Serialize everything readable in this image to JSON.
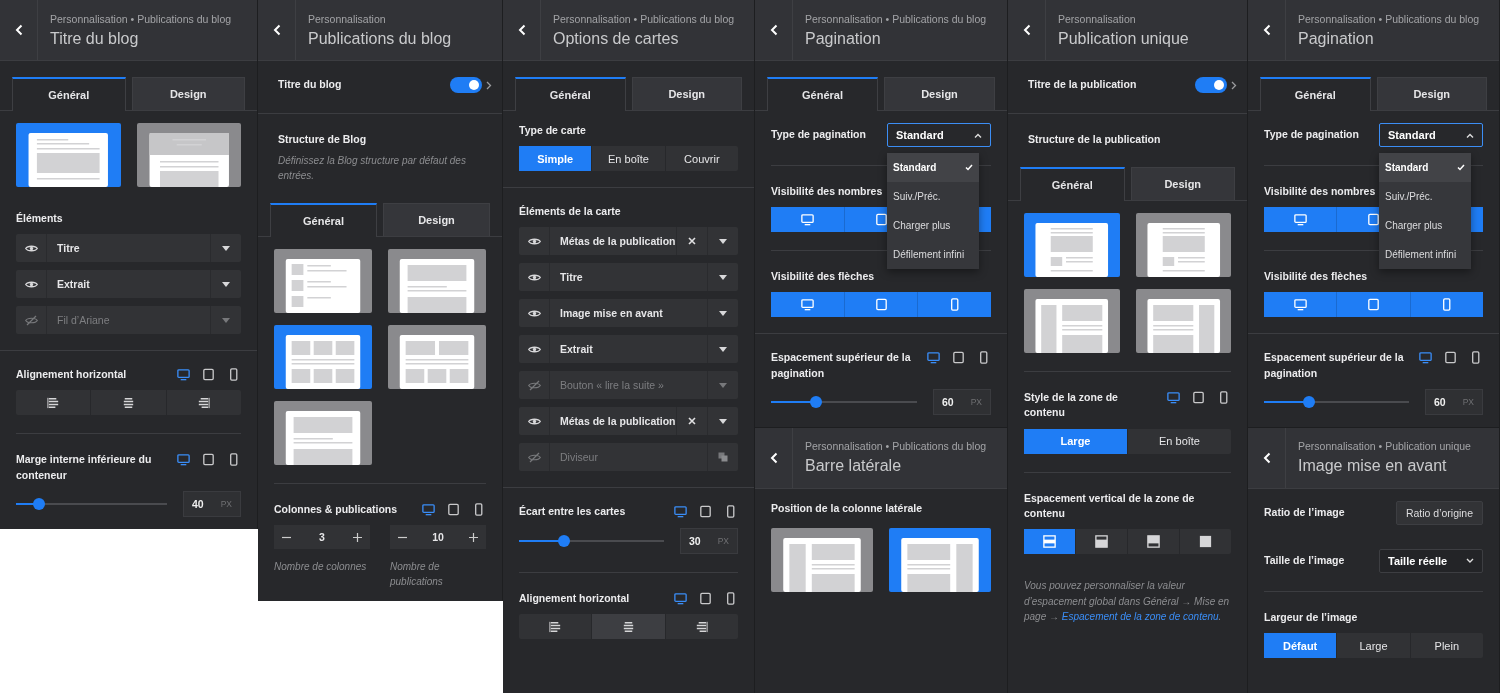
{
  "columns": [
    {
      "panels": [
        {
          "breadcrumb": "Personnalisation • Publications du blog",
          "title": "Titre du blog",
          "blocks": [
            {
              "kind": "tabs",
              "items": [
                {
                  "label": "Général",
                  "selected": true
                },
                {
                  "label": "Design",
                  "selected": false
                }
              ]
            },
            {
              "kind": "layouts",
              "items": [
                {
                  "kind": "stack",
                  "selected": true
                },
                {
                  "kind": "banner",
                  "selected": false
                }
              ]
            },
            {
              "kind": "elements",
              "label": "Éléments",
              "items": [
                {
                  "kind": "element",
                  "label": "Titre",
                  "visible": true,
                  "removable": false
                },
                {
                  "kind": "element",
                  "label": "Extrait",
                  "visible": true,
                  "removable": false
                },
                {
                  "kind": "element",
                  "label": "Fil d’Ariane",
                  "visible": false,
                  "removable": false
                }
              ]
            },
            {
              "kind": "divider",
              "inset": false
            },
            {
              "kind": "alignment",
              "label": "Alignement horizontal",
              "devices": [
                {
                  "kind": "desktop",
                  "selected": true
                },
                {
                  "kind": "tablet",
                  "selected": false
                },
                {
                  "kind": "mobile",
                  "selected": false
                }
              ],
              "options": [
                {
                  "kind": "align-left",
                  "selected": false
                },
                {
                  "kind": "align-center",
                  "selected": false
                },
                {
                  "kind": "align-right",
                  "selected": false
                }
              ]
            },
            {
              "kind": "divider",
              "inset": true
            },
            {
              "kind": "slider",
              "label": "Marge interne inférieure du conteneur",
              "devices": [
                {
                  "kind": "desktop",
                  "selected": true
                },
                {
                  "kind": "tablet",
                  "selected": false
                },
                {
                  "kind": "mobile",
                  "selected": false
                }
              ],
              "level": 0.15,
              "value": "40",
              "unit": "PX"
            }
          ]
        }
      ]
    },
    {
      "panels": [
        {
          "breadcrumb": "Personnalisation",
          "title": "Publications du blog",
          "blocks": [
            {
              "kind": "toggle",
              "label": "Titre du blog",
              "on": true
            },
            {
              "kind": "divider",
              "inset": false
            },
            {
              "kind": "heading",
              "label": "Structure de Blog",
              "description": "Définissez la Blog structure par défaut des entrées."
            },
            {
              "kind": "tabs",
              "items": [
                {
                  "label": "Général",
                  "selected": true
                },
                {
                  "label": "Design",
                  "selected": false
                }
              ]
            },
            {
              "kind": "layouts",
              "items": [
                {
                  "kind": "list",
                  "selected": false
                },
                {
                  "kind": "single",
                  "selected": false
                },
                {
                  "kind": "grid3",
                  "selected": true
                },
                {
                  "kind": "mixed",
                  "selected": false
                },
                {
                  "kind": "single",
                  "selected": false
                }
              ]
            },
            {
              "kind": "divider",
              "inset": true
            },
            {
              "kind": "steppers",
              "label": "Colonnes & publications",
              "devices": [
                {
                  "kind": "desktop",
                  "selected": true
                },
                {
                  "kind": "tablet",
                  "selected": false
                },
                {
                  "kind": "mobile",
                  "selected": false
                }
              ],
              "fields": [
                {
                  "value": "3",
                  "caption": "Nombre de colonnes"
                },
                {
                  "value": "10",
                  "caption": "Nombre de publications"
                }
              ]
            }
          ]
        }
      ]
    },
    {
      "panels": [
        {
          "breadcrumb": "Personnalisation • Publications du blog",
          "title": "Options de cartes",
          "blocks": [
            {
              "kind": "tabs",
              "items": [
                {
                  "label": "Général",
                  "selected": true
                },
                {
                  "label": "Design",
                  "selected": false
                }
              ]
            },
            {
              "kind": "segmented",
              "label": "Type de carte",
              "options": [
                {
                  "label": "Simple",
                  "selected": true
                },
                {
                  "label": "En boîte",
                  "selected": false
                },
                {
                  "label": "Couvrir",
                  "selected": false
                }
              ]
            },
            {
              "kind": "divider",
              "inset": false
            },
            {
              "kind": "elements",
              "label": "Éléments de la carte",
              "items": [
                {
                  "kind": "element",
                  "label": "Métas de la publication",
                  "visible": true,
                  "removable": true
                },
                {
                  "kind": "element",
                  "label": "Titre",
                  "visible": true,
                  "removable": false
                },
                {
                  "kind": "element",
                  "label": "Image mise en avant",
                  "visible": true,
                  "removable": false
                },
                {
                  "kind": "element",
                  "label": "Extrait",
                  "visible": true,
                  "removable": false
                },
                {
                  "kind": "element",
                  "label": "Bouton « lire la suite »",
                  "visible": false,
                  "removable": false
                },
                {
                  "kind": "element",
                  "label": "Métas de la publication",
                  "visible": true,
                  "removable": true
                },
                {
                  "kind": "divider",
                  "label": "Diviseur",
                  "visible": false,
                  "removable": false
                }
              ]
            },
            {
              "kind": "divider",
              "inset": false
            },
            {
              "kind": "slider",
              "label": "Écart entre les cartes",
              "devices": [
                {
                  "kind": "desktop",
                  "selected": true
                },
                {
                  "kind": "tablet",
                  "selected": false
                },
                {
                  "kind": "mobile",
                  "selected": false
                }
              ],
              "level": 0.31,
              "value": "30",
              "unit": "PX"
            },
            {
              "kind": "divider",
              "inset": true
            },
            {
              "kind": "alignment",
              "label": "Alignement horizontal",
              "devices": [
                {
                  "kind": "desktop",
                  "selected": true
                },
                {
                  "kind": "tablet",
                  "selected": false
                },
                {
                  "kind": "mobile",
                  "selected": false
                }
              ],
              "options": [
                {
                  "kind": "align-left",
                  "selected": false
                },
                {
                  "kind": "align-center",
                  "selected": true
                },
                {
                  "kind": "align-right",
                  "selected": false
                }
              ]
            }
          ]
        }
      ]
    },
    {
      "panels": [
        {
          "breadcrumb": "Personnalisation • Publications du blog",
          "title": "Pagination",
          "blocks": [
            {
              "kind": "tabs",
              "items": [
                {
                  "label": "Général",
                  "selected": true
                },
                {
                  "label": "Design",
                  "selected": false
                }
              ]
            },
            {
              "kind": "select",
              "label": "Type de pagination",
              "value": "Standard",
              "open": true,
              "options": [
                {
                  "label": "Standard",
                  "selected": true
                },
                {
                  "label": "Suiv./Préc.",
                  "selected": false
                },
                {
                  "label": "Charger plus",
                  "selected": false
                },
                {
                  "label": "Défilement infini",
                  "selected": false
                }
              ]
            },
            {
              "kind": "divider",
              "inset": true
            },
            {
              "kind": "segmented",
              "label": "Visibilité des nombres",
              "options": [
                {
                  "kind": "desktop",
                  "selected": true
                },
                {
                  "kind": "tablet",
                  "selected": true
                },
                {
                  "selected": true
                }
              ]
            },
            {
              "kind": "divider",
              "inset": true
            },
            {
              "kind": "segmented",
              "label": "Visibilité des flèches",
              "options": [
                {
                  "kind": "desktop",
                  "selected": true
                },
                {
                  "kind": "tablet",
                  "selected": true
                },
                {
                  "kind": "mobile",
                  "selected": true
                }
              ]
            },
            {
              "kind": "divider",
              "inset": false
            },
            {
              "kind": "slider",
              "label": "Espacement supérieur de la pagination",
              "devices": [
                {
                  "kind": "desktop",
                  "selected": true
                },
                {
                  "kind": "tablet",
                  "selected": false
                },
                {
                  "kind": "mobile",
                  "selected": false
                }
              ],
              "level": 0.31,
              "value": "60",
              "unit": "PX"
            }
          ]
        },
        {
          "breadcrumb": "Personnalisation • Publications du blog",
          "title": "Barre latérale",
          "blocks": [
            {
              "kind": "layouts",
              "label": "Position de la colonne latérale",
              "items": [
                {
                  "kind": "sidebar-left",
                  "selected": false
                },
                {
                  "kind": "sidebar-right",
                  "selected": true
                }
              ]
            }
          ]
        }
      ]
    },
    {
      "panels": [
        {
          "breadcrumb": "Personnalisation",
          "title": "Publication unique",
          "blocks": [
            {
              "kind": "toggle",
              "label": "Titre de la publication",
              "on": true
            },
            {
              "kind": "divider",
              "inset": false
            },
            {
              "kind": "heading",
              "label": "Structure de la publication"
            },
            {
              "kind": "tabs",
              "items": [
                {
                  "label": "Général",
                  "selected": true
                },
                {
                  "label": "Design",
                  "selected": false
                }
              ]
            },
            {
              "kind": "layouts",
              "items": [
                {
                  "kind": "post",
                  "selected": true
                },
                {
                  "kind": "post",
                  "selected": false
                },
                {
                  "kind": "sidebar-left",
                  "selected": false
                },
                {
                  "kind": "sidebar-right",
                  "selected": false
                }
              ]
            },
            {
              "kind": "divider",
              "inset": true
            },
            {
              "kind": "segmented",
              "label": "Style de la zone de contenu",
              "devices": [
                {
                  "kind": "desktop",
                  "selected": true
                },
                {
                  "kind": "tablet",
                  "selected": false
                },
                {
                  "kind": "mobile",
                  "selected": false
                }
              ],
              "options": [
                {
                  "label": "Large",
                  "selected": true
                },
                {
                  "label": "En boîte",
                  "selected": false
                }
              ]
            },
            {
              "kind": "divider",
              "inset": true
            },
            {
              "kind": "segmented",
              "label": "Espacement vertical de la zone de contenu",
              "options": [
                {
                  "kind": "pad-both",
                  "selected": true
                },
                {
                  "kind": "pad-top",
                  "selected": false
                },
                {
                  "kind": "pad-bottom",
                  "selected": false
                },
                {
                  "kind": "pad-none",
                  "selected": false
                }
              ]
            },
            {
              "kind": "note",
              "text": "Vous pouvez personnaliser la valeur d’espacement global dans Général → Mise en page → ",
              "link": "Espacement de la zone de contenu",
              "after": "."
            }
          ]
        }
      ]
    },
    {
      "panels": [
        {
          "breadcrumb": "Personnalisation • Publications du blog",
          "title": "Pagination",
          "blocks": [
            {
              "kind": "tabs",
              "items": [
                {
                  "label": "Général",
                  "selected": true
                },
                {
                  "label": "Design",
                  "selected": false
                }
              ]
            },
            {
              "kind": "select",
              "label": "Type de pagination",
              "value": "Standard",
              "open": true,
              "options": [
                {
                  "label": "Standard",
                  "selected": true
                },
                {
                  "label": "Suiv./Préc.",
                  "selected": false
                },
                {
                  "label": "Charger plus",
                  "selected": false
                },
                {
                  "label": "Défilement infini",
                  "selected": false
                }
              ]
            },
            {
              "kind": "divider",
              "inset": true
            },
            {
              "kind": "segmented",
              "label": "Visibilité des nombres",
              "options": [
                {
                  "kind": "desktop",
                  "selected": true
                },
                {
                  "kind": "tablet",
                  "selected": true
                },
                {
                  "selected": true
                }
              ]
            },
            {
              "kind": "divider",
              "inset": true
            },
            {
              "kind": "segmented",
              "label": "Visibilité des flèches",
              "options": [
                {
                  "kind": "desktop",
                  "selected": true
                },
                {
                  "kind": "tablet",
                  "selected": true
                },
                {
                  "kind": "mobile",
                  "selected": true
                }
              ]
            },
            {
              "kind": "divider",
              "inset": false
            },
            {
              "kind": "slider",
              "label": "Espacement supérieur de la pagination",
              "devices": [
                {
                  "kind": "desktop",
                  "selected": true
                },
                {
                  "kind": "tablet",
                  "selected": false
                },
                {
                  "kind": "mobile",
                  "selected": false
                }
              ],
              "level": 0.31,
              "value": "60",
              "unit": "PX"
            }
          ]
        },
        {
          "breadcrumb": "Personnalisation • Publication unique",
          "title": "Image mise en avant",
          "blocks": [
            {
              "kind": "button_row",
              "label": "Ratio de l’image",
              "button": "Ratio d’origine"
            },
            {
              "kind": "select",
              "label": "Taille de l’image",
              "value": "Taille réelle",
              "open": false
            },
            {
              "kind": "divider",
              "inset": true
            },
            {
              "kind": "segmented",
              "label": "Largeur de l’image",
              "options": [
                {
                  "label": "Défaut",
                  "selected": true
                },
                {
                  "label": "Large",
                  "selected": false
                },
                {
                  "label": "Plein",
                  "selected": false
                }
              ]
            }
          ]
        }
      ]
    }
  ]
}
